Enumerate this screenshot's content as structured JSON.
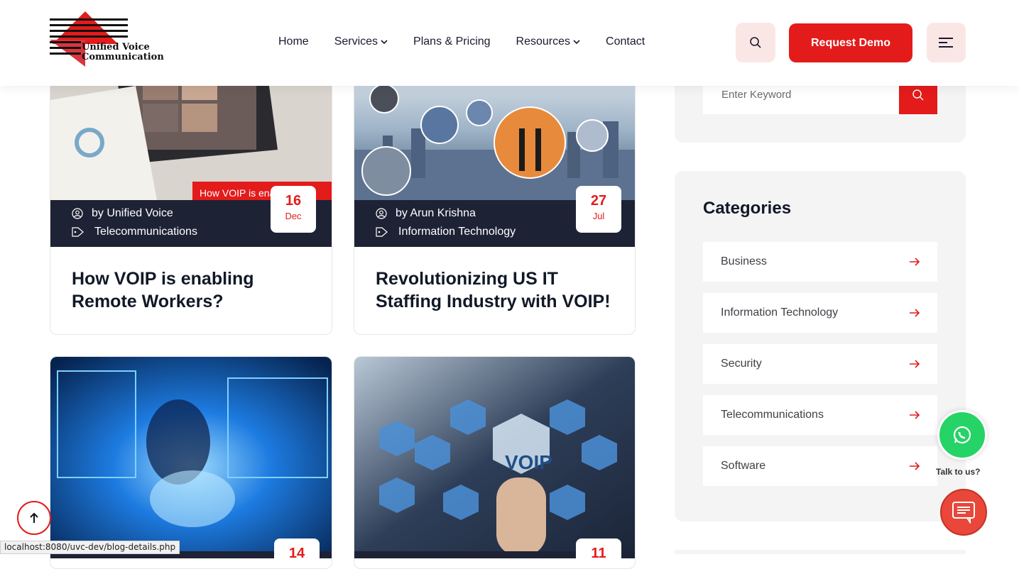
{
  "header": {
    "logo_line1": "Unified Voice",
    "logo_line2": "Communication",
    "nav": [
      {
        "label": "Home",
        "dropdown": false
      },
      {
        "label": "Services",
        "dropdown": true
      },
      {
        "label": "Plans & Pricing",
        "dropdown": false
      },
      {
        "label": "Resources",
        "dropdown": true
      },
      {
        "label": "Contact",
        "dropdown": false
      }
    ],
    "search_icon": "search-icon",
    "demo_label": "Request Demo",
    "menu_icon": "hamburger-icon"
  },
  "posts": [
    {
      "author": "by Unified Voice",
      "category": "Telecommunications",
      "day": "16",
      "month": "Dec",
      "title": "How VOIP is enabling Remote Workers?",
      "image_caption": "How VOIP is enab"
    },
    {
      "author": "by Arun Krishna",
      "category": "Information Technology",
      "day": "27",
      "month": "Jul",
      "title": "Revolutionizing US IT Staffing Industry with VOIP!"
    },
    {
      "day": "14"
    },
    {
      "day": "11",
      "image_label": "VOIP"
    }
  ],
  "sidebar": {
    "search_placeholder": "Enter Keyword",
    "categories_heading": "Categories",
    "categories": [
      "Business",
      "Information Technology",
      "Security",
      "Telecommunications",
      "Software"
    ]
  },
  "floating": {
    "talk_label": "Talk to us?"
  },
  "status_bar": "localhost:8080/uvc-dev/blog-details.php",
  "colors": {
    "accent": "#e31b1b",
    "dark": "#1e2235",
    "sidebar_bg": "#f4f4f5",
    "whatsapp": "#25d366"
  }
}
